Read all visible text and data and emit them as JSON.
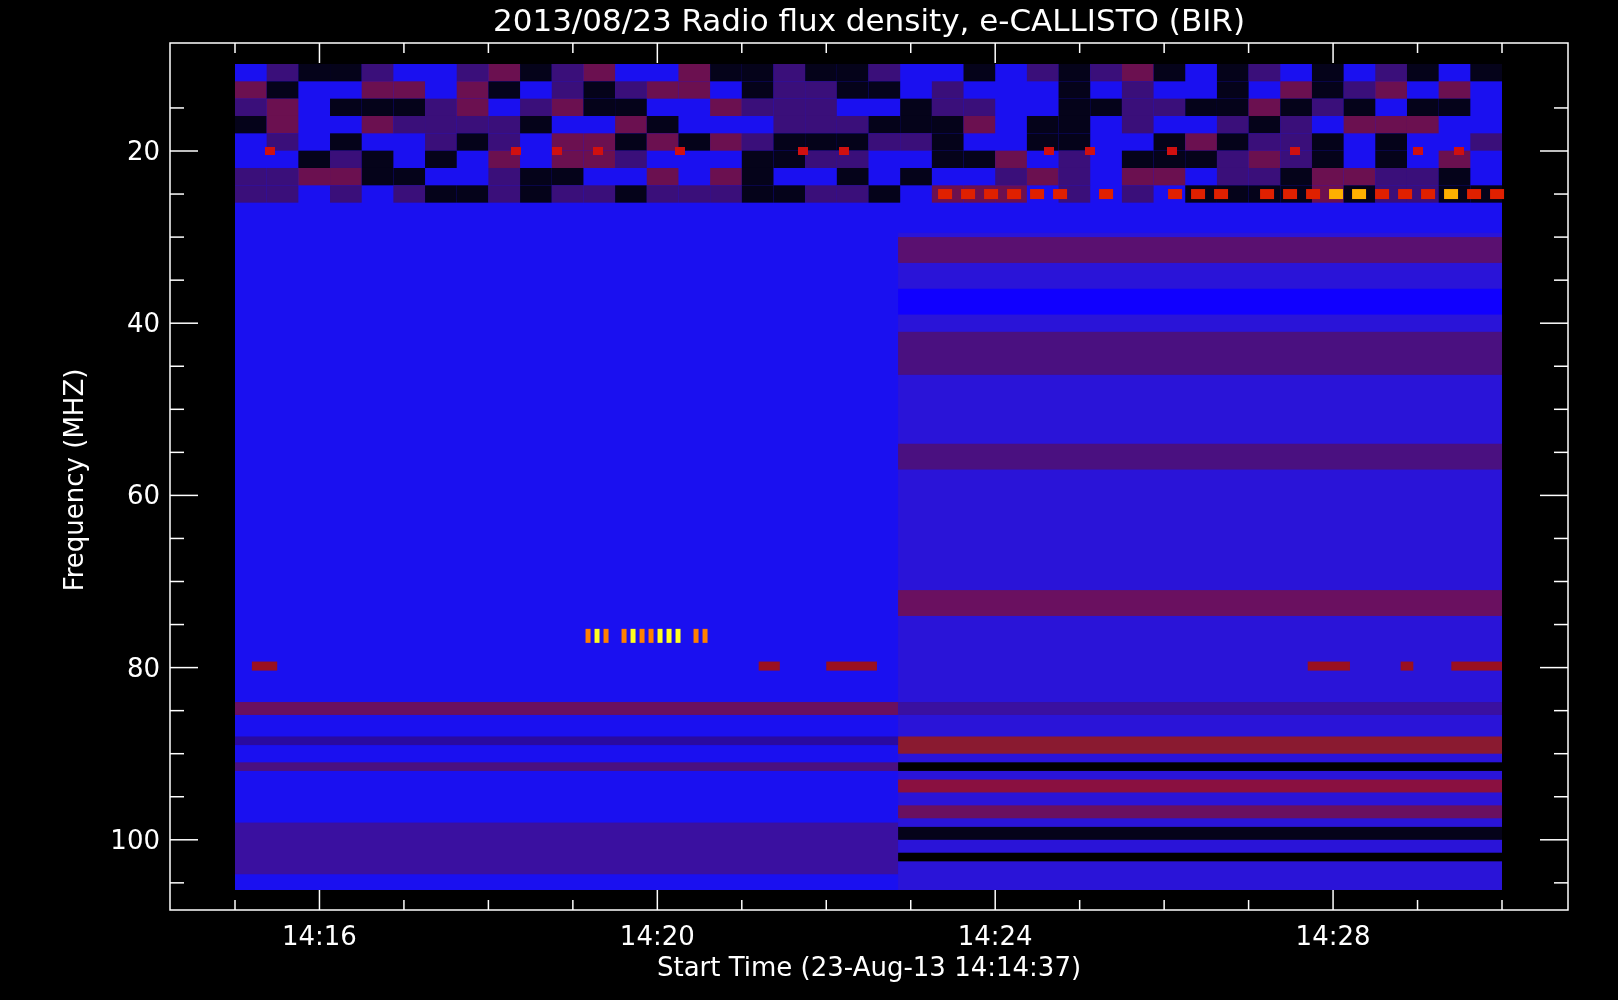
{
  "title": "2013/08/23  Radio flux density, e-CALLISTO (BIR)",
  "x_axis": {
    "label": "Start Time (23-Aug-13 14:14:37)",
    "ticks": [
      "14:16",
      "14:20",
      "14:24",
      "14:28"
    ]
  },
  "y_axis": {
    "label": "Frequency (MHZ)",
    "ticks": [
      "20",
      "40",
      "60",
      "80",
      "100"
    ]
  }
}
